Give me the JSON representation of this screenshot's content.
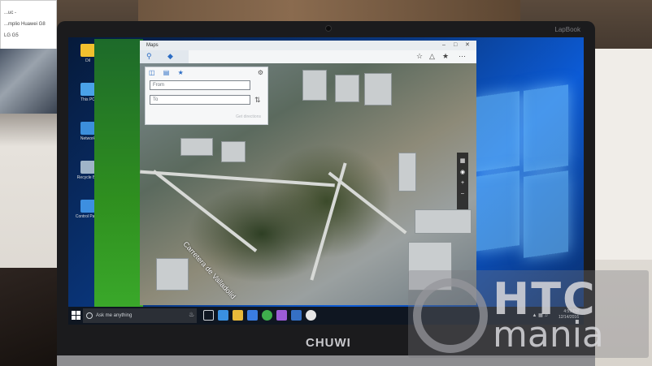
{
  "background": {
    "card_lines": [
      "...uc -",
      "...mplio Huawei G8",
      "LG G5"
    ]
  },
  "laptop": {
    "model_label": "LapBook",
    "brand": "CHUWI"
  },
  "desktop": {
    "icons": [
      {
        "label": "Dil",
        "color": "#f2c02e"
      },
      {
        "label": "This PC",
        "color": "#4aa2e8"
      },
      {
        "label": "Network",
        "color": "#3c8fdc"
      },
      {
        "label": "Recycle Bin",
        "color": "#9fb4c8"
      },
      {
        "label": "Control Panel",
        "color": "#3d8fe0"
      }
    ]
  },
  "maps": {
    "title": "Maps",
    "directions": {
      "from_placeholder": "From",
      "to_placeholder": "To",
      "go_label": "Get directions"
    },
    "street_label": "Carretera de Valladolid"
  },
  "taskbar": {
    "search_placeholder": "Ask me anything",
    "clock_time": "4:59 PM",
    "clock_date": "12/14/2016",
    "app_colors": [
      "#3a90e0",
      "#e8b93a",
      "#3a7ce0",
      "#3fae4d",
      "#9c5cd6",
      "#3570c4",
      "#e6e6e6"
    ]
  },
  "watermark": {
    "line1": "HTC",
    "line2": "mania"
  }
}
